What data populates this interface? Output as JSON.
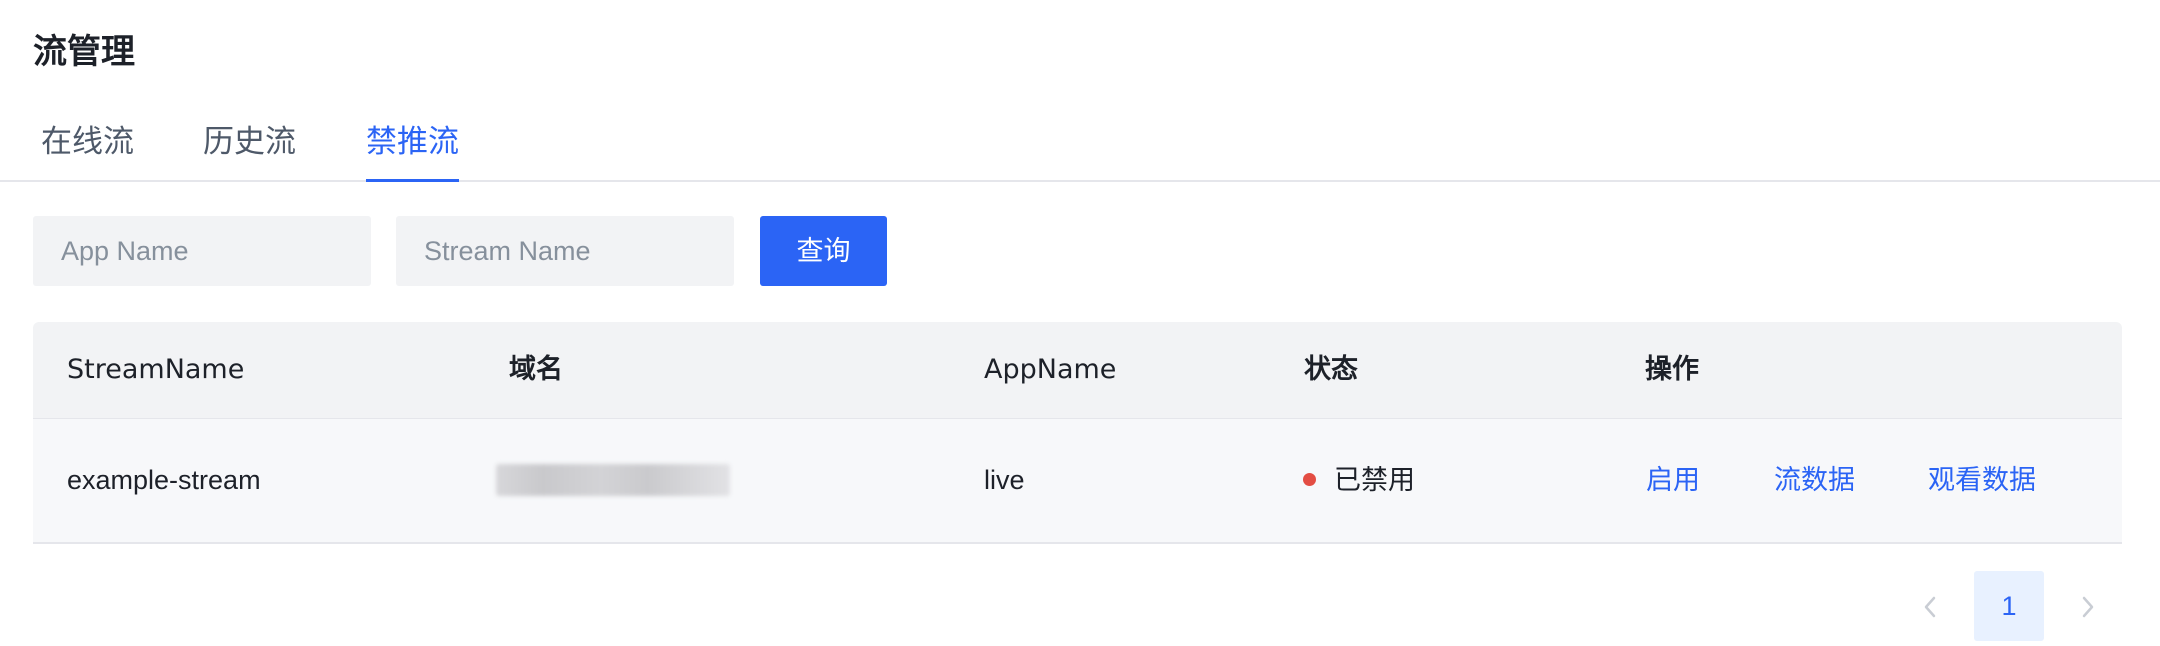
{
  "page": {
    "title": "流管理"
  },
  "tabs": [
    {
      "label": "在线流",
      "active": false
    },
    {
      "label": "历史流",
      "active": false
    },
    {
      "label": "禁推流",
      "active": true
    }
  ],
  "search": {
    "app_name_placeholder": "App Name",
    "stream_name_placeholder": "Stream Name",
    "query_label": "查询"
  },
  "table": {
    "columns": [
      "StreamName",
      "域名",
      "AppName",
      "状态",
      "操作"
    ],
    "rows": [
      {
        "stream_name": "example-stream",
        "domain": "",
        "app_name": "live",
        "status": "已禁用",
        "status_color": "#e34d43",
        "actions": [
          "启用",
          "流数据",
          "观看数据"
        ]
      }
    ]
  },
  "pagination": {
    "current_page": "1",
    "prev_icon": "chevron-left-icon",
    "next_icon": "chevron-right-icon"
  },
  "colors": {
    "accent": "#2b64f5",
    "status_disabled": "#e34d43"
  }
}
